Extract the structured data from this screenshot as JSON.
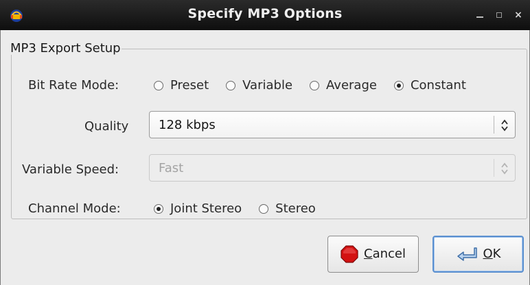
{
  "window": {
    "title": "Specify MP3 Options"
  },
  "group": {
    "legend": "MP3 Export Setup"
  },
  "bit_rate_mode": {
    "label": "Bit Rate Mode:",
    "options": [
      {
        "label": "Preset",
        "selected": false
      },
      {
        "label": "Variable",
        "selected": false
      },
      {
        "label": "Average",
        "selected": false
      },
      {
        "label": "Constant",
        "selected": true
      }
    ]
  },
  "quality": {
    "label": "Quality",
    "value": "128 kbps"
  },
  "variable_speed": {
    "label": "Variable Speed:",
    "value": "Fast",
    "enabled": false
  },
  "channel_mode": {
    "label": "Channel Mode:",
    "options": [
      {
        "label": "Joint Stereo",
        "selected": true
      },
      {
        "label": "Stereo",
        "selected": false
      }
    ]
  },
  "buttons": {
    "cancel": {
      "mnemonic": "C",
      "rest": "ancel"
    },
    "ok": {
      "mnemonic": "O",
      "rest": "K"
    }
  },
  "colors": {
    "titlebar": "#1a1a1a",
    "dialog_bg": "#ececec",
    "default_button_border": "#5a8fcf",
    "stop_icon": "#d31212"
  }
}
